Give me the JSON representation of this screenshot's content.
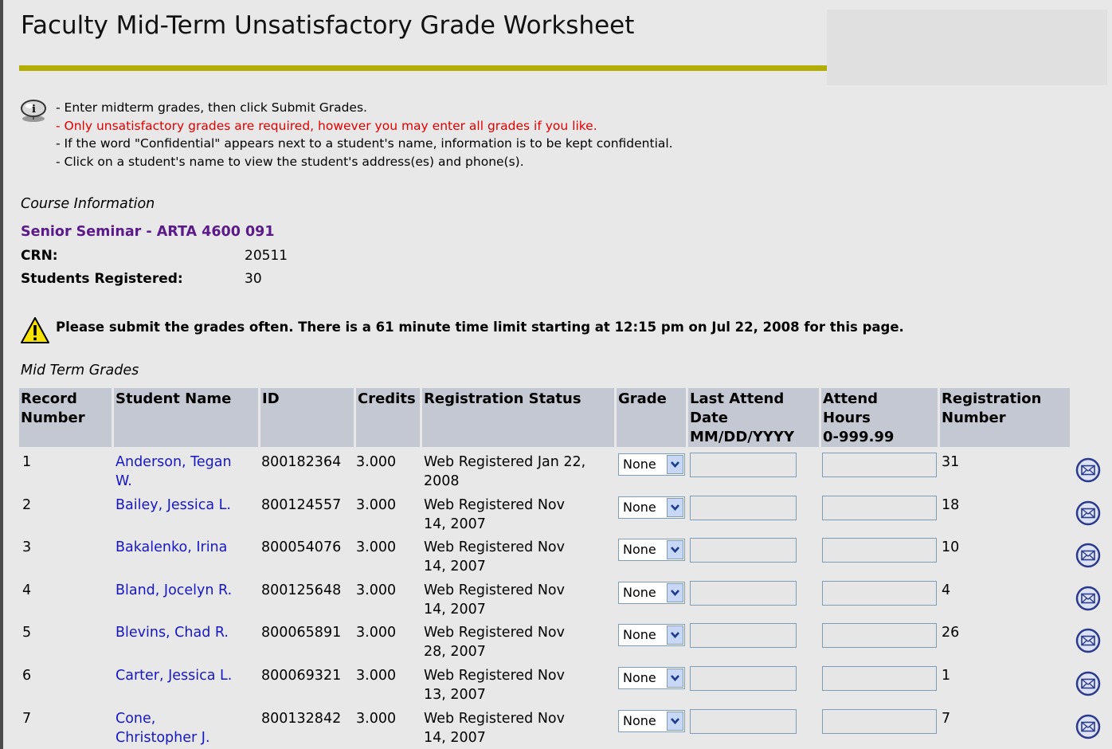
{
  "page": {
    "title": "Faculty Mid-Term Unsatisfactory Grade Worksheet"
  },
  "info": {
    "icon": "info-icon",
    "lines": [
      "- Enter midterm grades, then click Submit Grades.",
      "- Only unsatisfactory grades are required, however you may enter all grades if you like.",
      "- If the word \"Confidential\" appears next to a student's name, information is to be kept confidential.",
      "- Click on a student's name to view the student's address(es) and phone(s)."
    ]
  },
  "course": {
    "section_label": "Course Information",
    "title": "Senior Seminar - ARTA 4600 091",
    "crn_label": "CRN:",
    "crn": "20511",
    "students_label": "Students Registered:",
    "students": "30"
  },
  "warning": {
    "icon": "warning-icon",
    "text": "Please submit the grades often. There is a 61 minute time limit starting at 12:15 pm on Jul 22, 2008 for this page."
  },
  "grades": {
    "section_label": "Mid Term Grades",
    "headers": {
      "record": [
        "Record",
        "Number"
      ],
      "student": [
        "Student Name"
      ],
      "id": [
        "ID"
      ],
      "credits": [
        "Credits"
      ],
      "status": [
        "Registration Status"
      ],
      "grade": [
        "Grade"
      ],
      "last_attend": [
        "Last Attend",
        "Date",
        "MM/DD/YYYY"
      ],
      "attend_hours": [
        "Attend",
        "Hours",
        "0-999.99"
      ],
      "reg_number": [
        "Registration",
        "Number"
      ]
    },
    "rows": [
      {
        "record": "1",
        "name": [
          "Anderson, Tegan",
          "W."
        ],
        "id": "800182364",
        "credits": "3.000",
        "status": [
          "Web Registered Jan 22,",
          "2008"
        ],
        "grade": "None",
        "last_attend": "",
        "hours": "",
        "reg": "31"
      },
      {
        "record": "2",
        "name": [
          "Bailey, Jessica L."
        ],
        "id": "800124557",
        "credits": "3.000",
        "status": [
          "Web Registered Nov",
          "14, 2007"
        ],
        "grade": "None",
        "last_attend": "",
        "hours": "",
        "reg": "18"
      },
      {
        "record": "3",
        "name": [
          "Bakalenko, Irina"
        ],
        "id": "800054076",
        "credits": "3.000",
        "status": [
          "Web Registered Nov",
          "14, 2007"
        ],
        "grade": "None",
        "last_attend": "",
        "hours": "",
        "reg": "10"
      },
      {
        "record": "4",
        "name": [
          "Bland, Jocelyn R."
        ],
        "id": "800125648",
        "credits": "3.000",
        "status": [
          "Web Registered Nov",
          "14, 2007"
        ],
        "grade": "None",
        "last_attend": "",
        "hours": "",
        "reg": "4"
      },
      {
        "record": "5",
        "name": [
          "Blevins, Chad R."
        ],
        "id": "800065891",
        "credits": "3.000",
        "status": [
          "Web Registered Nov",
          "28, 2007"
        ],
        "grade": "None",
        "last_attend": "",
        "hours": "",
        "reg": "26"
      },
      {
        "record": "6",
        "name": [
          "Carter, Jessica L."
        ],
        "id": "800069321",
        "credits": "3.000",
        "status": [
          "Web Registered Nov",
          "13, 2007"
        ],
        "grade": "None",
        "last_attend": "",
        "hours": "",
        "reg": "1"
      },
      {
        "record": "7",
        "name": [
          "Cone,",
          "Christopher J."
        ],
        "id": "800132842",
        "credits": "3.000",
        "status": [
          "Web Registered Nov",
          "14, 2007"
        ],
        "grade": "None",
        "last_attend": "",
        "hours": "",
        "reg": "7"
      }
    ]
  },
  "colors": {
    "accent_bar": "#b3ad00",
    "header_bg": "#c4c8d3",
    "link": "#1717c5",
    "course_title": "#5b1a8a",
    "notice_red": "#e40000"
  }
}
